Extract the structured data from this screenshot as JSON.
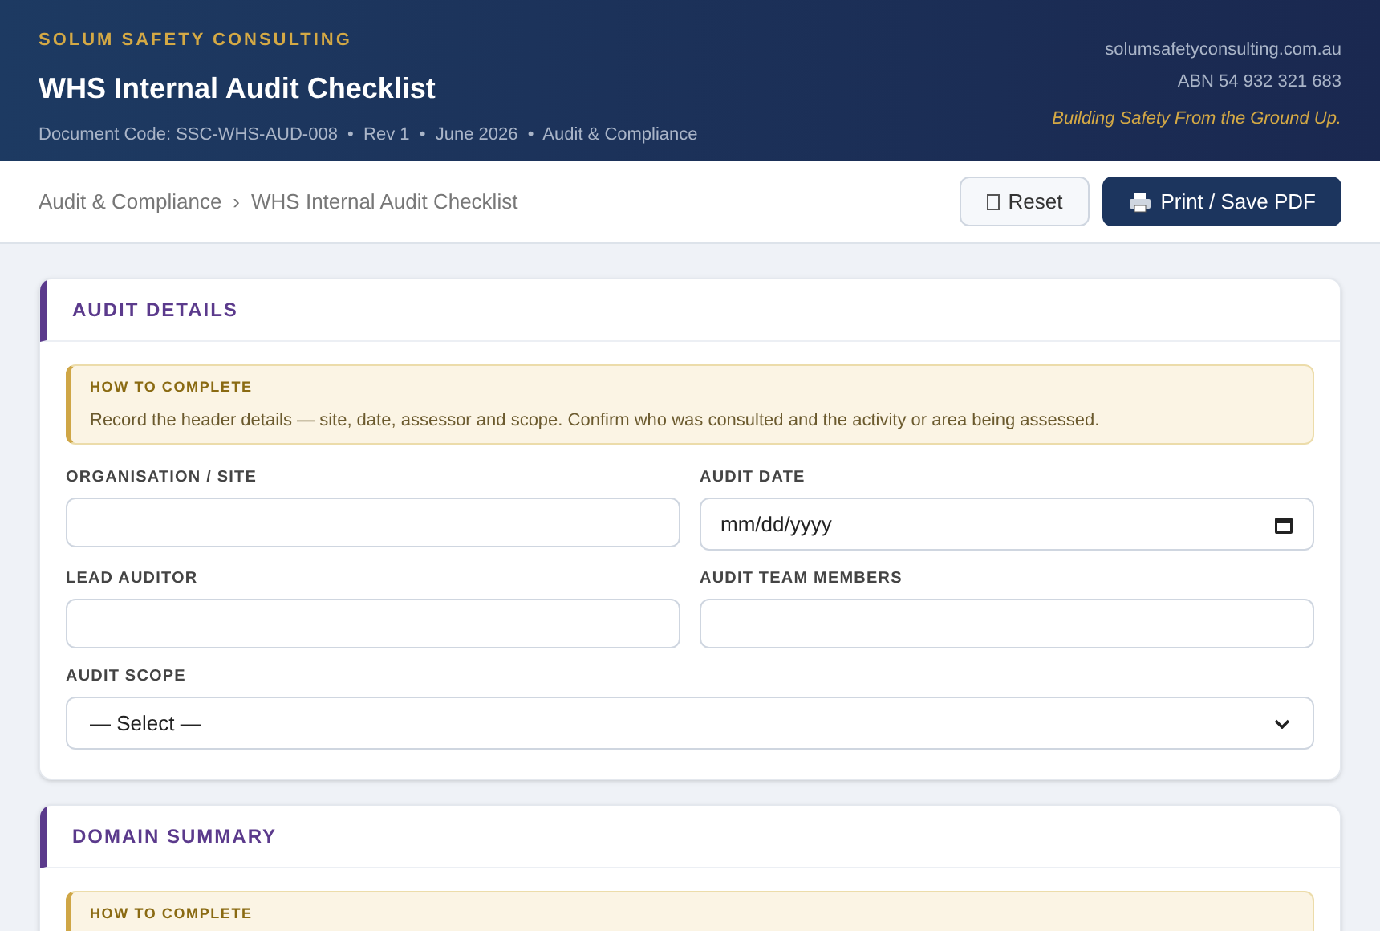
{
  "header": {
    "company": "SOLUM SAFETY CONSULTING",
    "title": "WHS Internal Audit Checklist",
    "meta": "Document Code: SSC-WHS-AUD-008  •  Rev 1  •  June 2026  •  Audit & Compliance",
    "website": "solumsafetyconsulting.com.au",
    "abn": "ABN 54 932 321 683",
    "tagline": "Building Safety From the Ground Up."
  },
  "breadcrumb": {
    "items": [
      "Audit & Compliance",
      "WHS Internal Audit Checklist"
    ],
    "separator": "›"
  },
  "buttons": [
    {
      "kind": "reset",
      "label": "Reset"
    },
    {
      "kind": "print",
      "label": "Print / Save PDF"
    }
  ],
  "sections": [
    {
      "title": "AUDIT DETAILS",
      "notice": {
        "title": "HOW TO COMPLETE",
        "text": "Record the header details — site, date, assessor and scope. Confirm who was consulted and the activity or area being assessed."
      },
      "fields": [
        {
          "kind": "text",
          "label": "ORGANISATION / SITE"
        },
        {
          "kind": "date",
          "label": "AUDIT DATE",
          "placeholder": "mm/dd/yyyy"
        },
        {
          "kind": "text",
          "label": "LEAD AUDITOR"
        },
        {
          "kind": "text",
          "label": "AUDIT TEAM MEMBERS"
        },
        {
          "kind": "select",
          "label": "AUDIT SCOPE",
          "value": "— Select —"
        }
      ]
    },
    {
      "title": "DOMAIN SUMMARY",
      "notice": {
        "title": "HOW TO COMPLETE"
      }
    }
  ]
}
